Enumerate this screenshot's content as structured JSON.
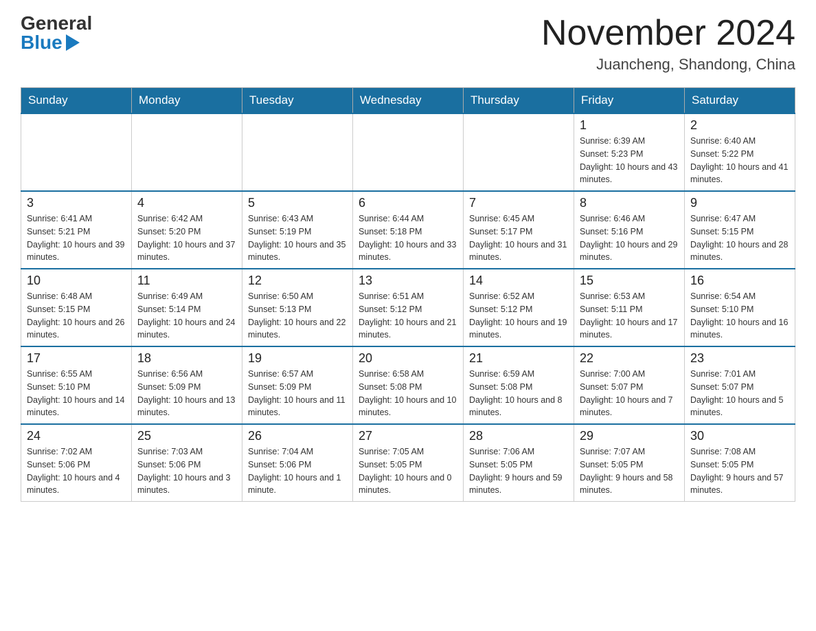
{
  "header": {
    "logo_general": "General",
    "logo_blue": "Blue",
    "month_title": "November 2024",
    "location": "Juancheng, Shandong, China"
  },
  "weekdays": [
    "Sunday",
    "Monday",
    "Tuesday",
    "Wednesday",
    "Thursday",
    "Friday",
    "Saturday"
  ],
  "weeks": [
    [
      {
        "day": "",
        "info": ""
      },
      {
        "day": "",
        "info": ""
      },
      {
        "day": "",
        "info": ""
      },
      {
        "day": "",
        "info": ""
      },
      {
        "day": "",
        "info": ""
      },
      {
        "day": "1",
        "info": "Sunrise: 6:39 AM\nSunset: 5:23 PM\nDaylight: 10 hours and 43 minutes."
      },
      {
        "day": "2",
        "info": "Sunrise: 6:40 AM\nSunset: 5:22 PM\nDaylight: 10 hours and 41 minutes."
      }
    ],
    [
      {
        "day": "3",
        "info": "Sunrise: 6:41 AM\nSunset: 5:21 PM\nDaylight: 10 hours and 39 minutes."
      },
      {
        "day": "4",
        "info": "Sunrise: 6:42 AM\nSunset: 5:20 PM\nDaylight: 10 hours and 37 minutes."
      },
      {
        "day": "5",
        "info": "Sunrise: 6:43 AM\nSunset: 5:19 PM\nDaylight: 10 hours and 35 minutes."
      },
      {
        "day": "6",
        "info": "Sunrise: 6:44 AM\nSunset: 5:18 PM\nDaylight: 10 hours and 33 minutes."
      },
      {
        "day": "7",
        "info": "Sunrise: 6:45 AM\nSunset: 5:17 PM\nDaylight: 10 hours and 31 minutes."
      },
      {
        "day": "8",
        "info": "Sunrise: 6:46 AM\nSunset: 5:16 PM\nDaylight: 10 hours and 29 minutes."
      },
      {
        "day": "9",
        "info": "Sunrise: 6:47 AM\nSunset: 5:15 PM\nDaylight: 10 hours and 28 minutes."
      }
    ],
    [
      {
        "day": "10",
        "info": "Sunrise: 6:48 AM\nSunset: 5:15 PM\nDaylight: 10 hours and 26 minutes."
      },
      {
        "day": "11",
        "info": "Sunrise: 6:49 AM\nSunset: 5:14 PM\nDaylight: 10 hours and 24 minutes."
      },
      {
        "day": "12",
        "info": "Sunrise: 6:50 AM\nSunset: 5:13 PM\nDaylight: 10 hours and 22 minutes."
      },
      {
        "day": "13",
        "info": "Sunrise: 6:51 AM\nSunset: 5:12 PM\nDaylight: 10 hours and 21 minutes."
      },
      {
        "day": "14",
        "info": "Sunrise: 6:52 AM\nSunset: 5:12 PM\nDaylight: 10 hours and 19 minutes."
      },
      {
        "day": "15",
        "info": "Sunrise: 6:53 AM\nSunset: 5:11 PM\nDaylight: 10 hours and 17 minutes."
      },
      {
        "day": "16",
        "info": "Sunrise: 6:54 AM\nSunset: 5:10 PM\nDaylight: 10 hours and 16 minutes."
      }
    ],
    [
      {
        "day": "17",
        "info": "Sunrise: 6:55 AM\nSunset: 5:10 PM\nDaylight: 10 hours and 14 minutes."
      },
      {
        "day": "18",
        "info": "Sunrise: 6:56 AM\nSunset: 5:09 PM\nDaylight: 10 hours and 13 minutes."
      },
      {
        "day": "19",
        "info": "Sunrise: 6:57 AM\nSunset: 5:09 PM\nDaylight: 10 hours and 11 minutes."
      },
      {
        "day": "20",
        "info": "Sunrise: 6:58 AM\nSunset: 5:08 PM\nDaylight: 10 hours and 10 minutes."
      },
      {
        "day": "21",
        "info": "Sunrise: 6:59 AM\nSunset: 5:08 PM\nDaylight: 10 hours and 8 minutes."
      },
      {
        "day": "22",
        "info": "Sunrise: 7:00 AM\nSunset: 5:07 PM\nDaylight: 10 hours and 7 minutes."
      },
      {
        "day": "23",
        "info": "Sunrise: 7:01 AM\nSunset: 5:07 PM\nDaylight: 10 hours and 5 minutes."
      }
    ],
    [
      {
        "day": "24",
        "info": "Sunrise: 7:02 AM\nSunset: 5:06 PM\nDaylight: 10 hours and 4 minutes."
      },
      {
        "day": "25",
        "info": "Sunrise: 7:03 AM\nSunset: 5:06 PM\nDaylight: 10 hours and 3 minutes."
      },
      {
        "day": "26",
        "info": "Sunrise: 7:04 AM\nSunset: 5:06 PM\nDaylight: 10 hours and 1 minute."
      },
      {
        "day": "27",
        "info": "Sunrise: 7:05 AM\nSunset: 5:05 PM\nDaylight: 10 hours and 0 minutes."
      },
      {
        "day": "28",
        "info": "Sunrise: 7:06 AM\nSunset: 5:05 PM\nDaylight: 9 hours and 59 minutes."
      },
      {
        "day": "29",
        "info": "Sunrise: 7:07 AM\nSunset: 5:05 PM\nDaylight: 9 hours and 58 minutes."
      },
      {
        "day": "30",
        "info": "Sunrise: 7:08 AM\nSunset: 5:05 PM\nDaylight: 9 hours and 57 minutes."
      }
    ]
  ]
}
